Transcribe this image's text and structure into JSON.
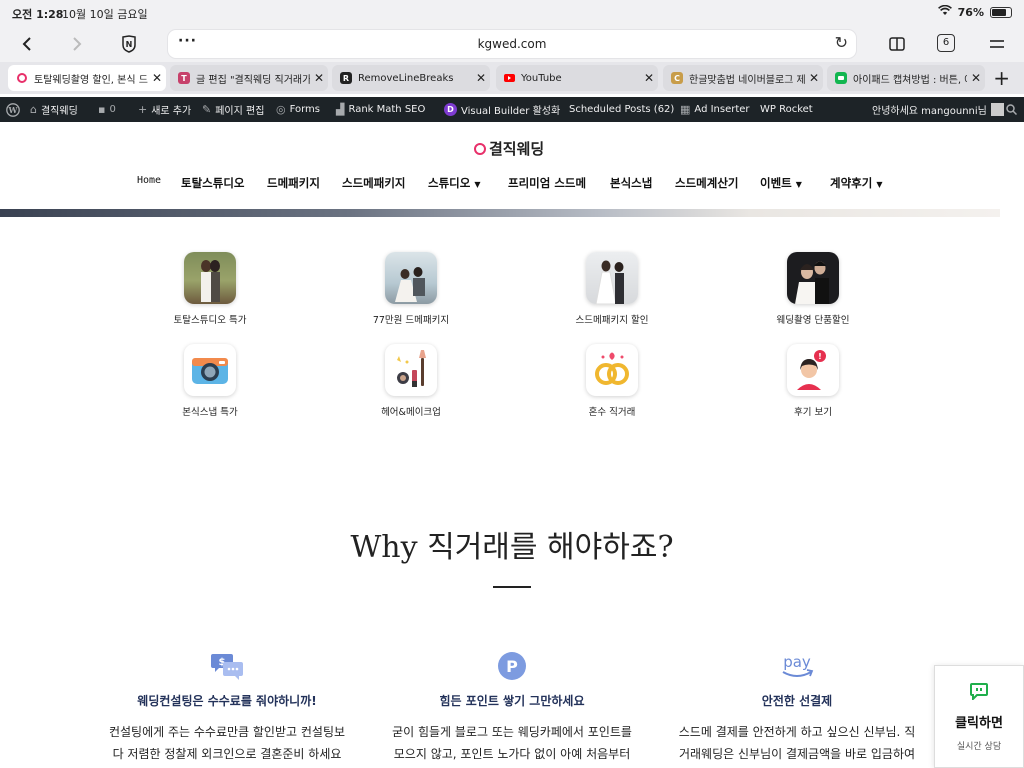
{
  "status": {
    "time": "오전 1:28",
    "date": "10월 10일 금요일",
    "battery": "76%",
    "battery_level": 0.76
  },
  "browser": {
    "url": "kgwed.com",
    "tab_count": "6",
    "tabs": [
      {
        "title": "토탈웨딩촬영 할인, 본식 드레",
        "color": "#ffffff"
      },
      {
        "title": "글 편집 \"결직웨딩 직거래가 유",
        "color": "#c7416b",
        "fav": "T"
      },
      {
        "title": "RemoveLineBreaks",
        "color": "#222222",
        "fav": "R"
      },
      {
        "title": "YouTube",
        "color": "#ff0000"
      },
      {
        "title": "한글맞춤법 네이버블로그 제목",
        "color": "#c89d4a",
        "fav": "C"
      },
      {
        "title": "아이패드 캡쳐방법 : 버튼, 애플",
        "color": "#12b650"
      }
    ]
  },
  "wpbar": {
    "site": "결직웨딩",
    "comments": "0",
    "new": "새로 추가",
    "edit": "페이지 편집",
    "forms": "Forms",
    "rankmath": "Rank Math SEO",
    "visual": "Visual Builder 활성화",
    "scheduled": "Scheduled Posts (62)",
    "adinserter": "Ad Inserter",
    "rocket": "WP Rocket",
    "greeting": "안녕하세요 mangounni님"
  },
  "site": {
    "logo": "결직웨딩",
    "nav": [
      {
        "label": "Home"
      },
      {
        "label": "토탈스튜디오"
      },
      {
        "label": "드메패키지"
      },
      {
        "label": "스드메패키지"
      },
      {
        "label": "스튜디오",
        "dropdown": true
      },
      {
        "label": "프리미엄 스드메"
      },
      {
        "label": "본식스냅"
      },
      {
        "label": "스드메계산기"
      },
      {
        "label": "이벤트",
        "dropdown": true
      },
      {
        "label": "계약후기",
        "dropdown": true
      }
    ]
  },
  "quick_menu": [
    {
      "label": "토탈스튜디오 특가",
      "icon": "couple-photo-icon"
    },
    {
      "label": "77만원 드메패키지",
      "icon": "couple-sitting-photo-icon"
    },
    {
      "label": "스드메패키지 할인",
      "icon": "bride-photo-icon"
    },
    {
      "label": "웨딩촬영 단품할인",
      "icon": "couple-portrait-icon"
    },
    {
      "label": "본식스냅 특가",
      "icon": "camera-icon"
    },
    {
      "label": "헤어&메이크업",
      "icon": "makeup-icon"
    },
    {
      "label": "혼수 직거래",
      "icon": "rings-icon"
    },
    {
      "label": "후기 보기",
      "icon": "review-icon"
    }
  ],
  "why": {
    "title": "Why 직거래를 해야하죠?",
    "features": [
      {
        "icon": "money-chat-icon",
        "title": "웨딩컨설팅은 수수료를 줘야하니까!",
        "desc": [
          "컨설팅에게 주는 수수료만큼 할인받고 컨설팅보",
          "다 저렴한 정찰제 외크인으로 결혼준비 하세요"
        ]
      },
      {
        "icon": "points-icon",
        "icon_text": "P",
        "title": "힘든 포인트 쌓기 그만하세요",
        "desc": [
          "굳이 힘들게 블로그 또는 웨딩카페에서 포인트를",
          "모으지 않고, 포인트 노가다 없이 아예 처음부터"
        ]
      },
      {
        "icon": "amazon-pay-icon",
        "icon_text": "pay",
        "title": "안전한 선결제",
        "desc": [
          "스드메 결제를 안전하게 하고 싶으신 신부님. 직",
          "거래웨딩은 신부님이 결제금액을 바로 입금하여"
        ]
      }
    ]
  },
  "chat": {
    "title": "클릭하면",
    "sub": "실시간 상담"
  }
}
